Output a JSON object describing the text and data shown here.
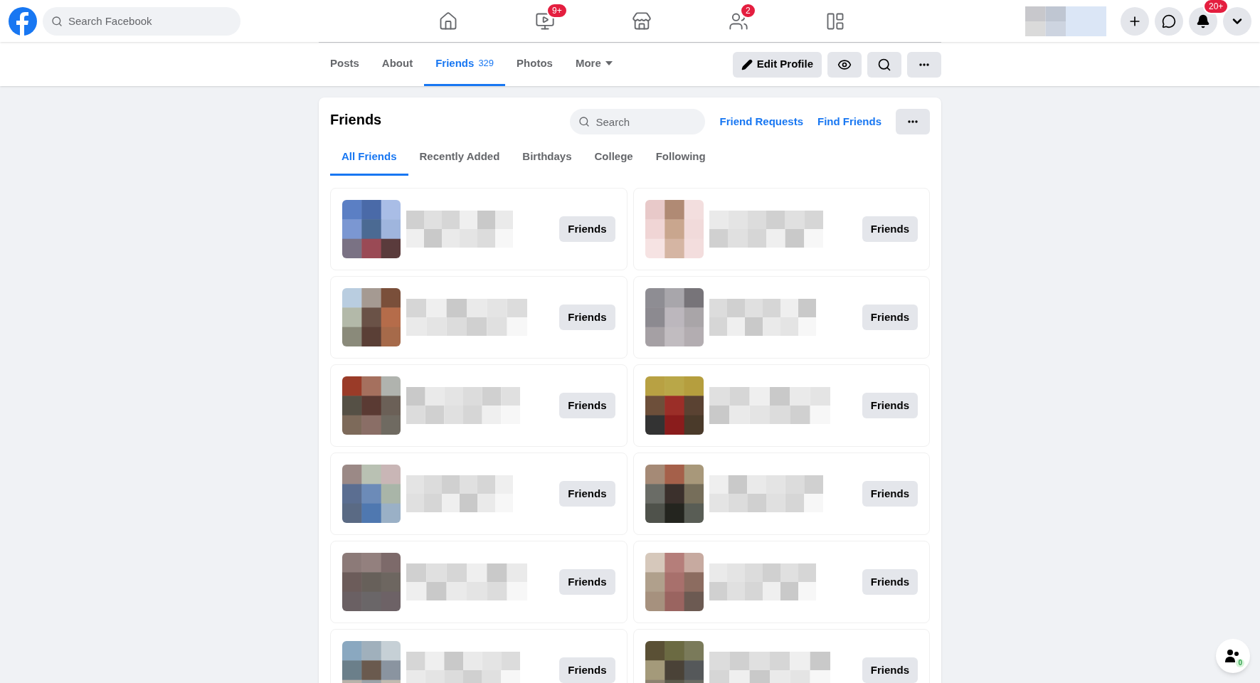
{
  "topbar": {
    "search_placeholder": "Search Facebook",
    "nav": [
      {
        "kind": "home"
      },
      {
        "kind": "watch",
        "badge": "9+"
      },
      {
        "kind": "marketplace"
      },
      {
        "kind": "groups",
        "badge": "2"
      },
      {
        "kind": "gaming"
      }
    ],
    "notifications_badge": "20+"
  },
  "profile_tabs": [
    {
      "label": "Posts",
      "selected": false
    },
    {
      "label": "About",
      "selected": false
    },
    {
      "label": "Friends",
      "count": "329",
      "selected": true
    },
    {
      "label": "Photos",
      "selected": false
    },
    {
      "label": "More",
      "selected": false
    }
  ],
  "profile_actions": {
    "edit": "Edit Profile"
  },
  "friends_card": {
    "title": "Friends",
    "search_placeholder": "Search",
    "links": [
      "Friend Requests",
      "Find Friends"
    ],
    "tabs": [
      {
        "label": "All Friends",
        "selected": true
      },
      {
        "label": "Recently Added",
        "selected": false
      },
      {
        "label": "Birthdays",
        "selected": false
      },
      {
        "label": "College",
        "selected": false
      },
      {
        "label": "Following",
        "selected": false
      }
    ],
    "friends": [
      {
        "button": "Friends"
      },
      {
        "button": "Friends"
      },
      {
        "button": "Friends"
      },
      {
        "button": "Friends"
      },
      {
        "button": "Friends"
      },
      {
        "button": "Friends"
      },
      {
        "button": "Friends"
      },
      {
        "button": "Friends"
      },
      {
        "button": "Friends"
      },
      {
        "button": "Friends"
      },
      {
        "button": "Friends"
      },
      {
        "button": "Friends"
      }
    ]
  },
  "contacts_badge": "0"
}
